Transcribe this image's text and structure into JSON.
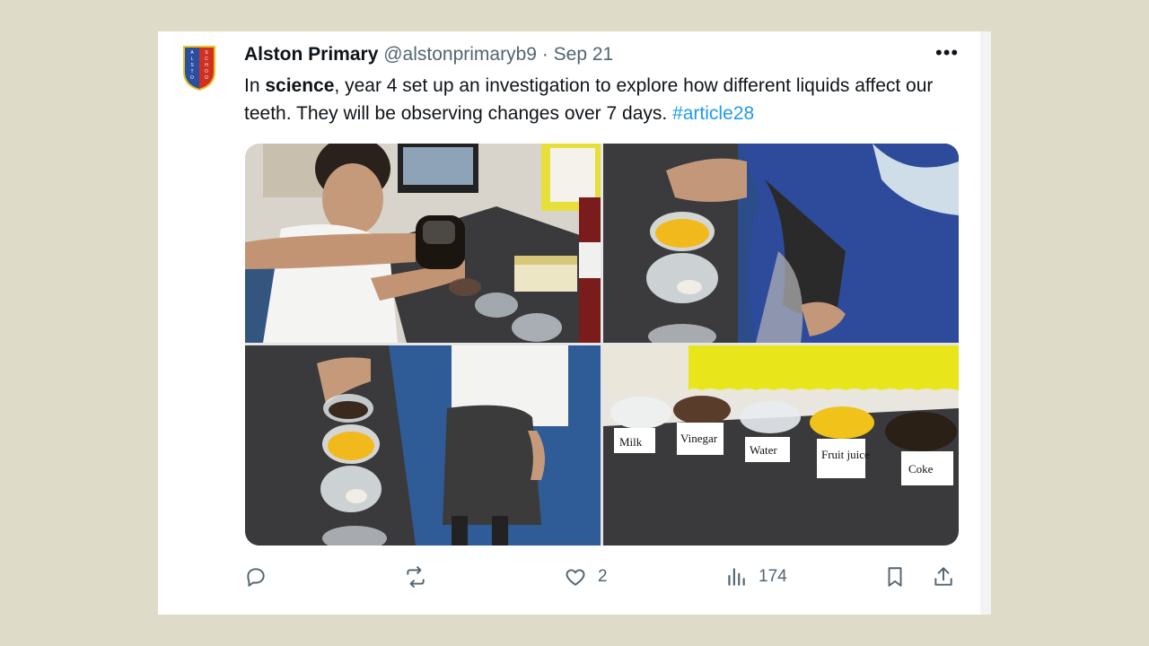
{
  "tweet": {
    "display_name": "Alston Primary",
    "handle": "@alstonprimaryb9",
    "separator": "·",
    "date": "Sep 21",
    "more_label": "•••",
    "text_before": "In ",
    "text_bold": "science",
    "text_after": ", year 4 set up an investigation to explore how different liquids affect our teeth. They will be observing changes over 7 days. ",
    "hashtag": "#article28"
  },
  "avatar": {
    "left_letters": "ALSTON",
    "right_letters": "SCHOOL",
    "colors": {
      "blue": "#2a4fa0",
      "red": "#d03020",
      "gold": "#e8c020"
    }
  },
  "media": {
    "labels": [
      "Milk",
      "Vinegar",
      "Water",
      "Fruit juice",
      "Coke"
    ],
    "colors": {
      "counter": "#3a3a3c",
      "wall_yellow": "#e8e61a",
      "uniform_blue": "#2e4a9a"
    }
  },
  "actions": {
    "reply": {
      "icon": "reply-icon",
      "count": ""
    },
    "retweet": {
      "icon": "retweet-icon",
      "count": ""
    },
    "like": {
      "icon": "heart-icon",
      "count": "2"
    },
    "views": {
      "icon": "views-icon",
      "count": "174"
    },
    "bookmark": {
      "icon": "bookmark-icon"
    },
    "share": {
      "icon": "share-icon"
    }
  }
}
